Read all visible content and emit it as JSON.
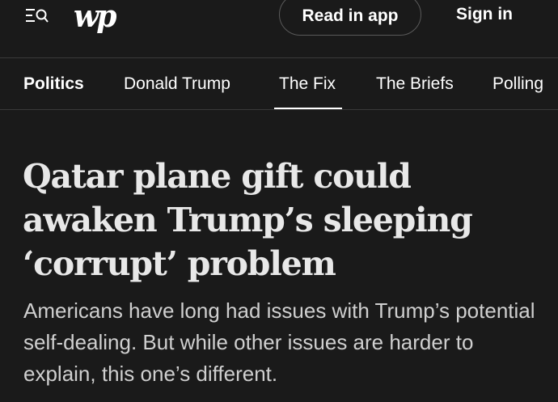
{
  "header": {
    "logo_text": "wp",
    "read_in_app_label": "Read in app",
    "sign_in_label": "Sign in",
    "menu_icon": "menu-search-icon"
  },
  "nav": {
    "items": [
      {
        "label": "Politics",
        "active": false,
        "bold": true
      },
      {
        "label": "Donald Trump",
        "active": false,
        "bold": false
      },
      {
        "label": "The Fix",
        "active": true,
        "bold": false
      },
      {
        "label": "The Briefs",
        "active": false,
        "bold": false
      },
      {
        "label": "Polling",
        "active": false,
        "bold": false
      }
    ]
  },
  "article": {
    "headline": "Qatar plane gift could awaken Trump’s sleeping ‘corrupt’ problem",
    "dek": "Americans have long had issues with Trump’s potential self-dealing. But while other issues are harder to explain, this one’s different."
  },
  "colors": {
    "background": "#1a1a1a",
    "divider": "#3a3a3a",
    "headline": "#e8e8e8",
    "dek": "#cfcfcf"
  }
}
